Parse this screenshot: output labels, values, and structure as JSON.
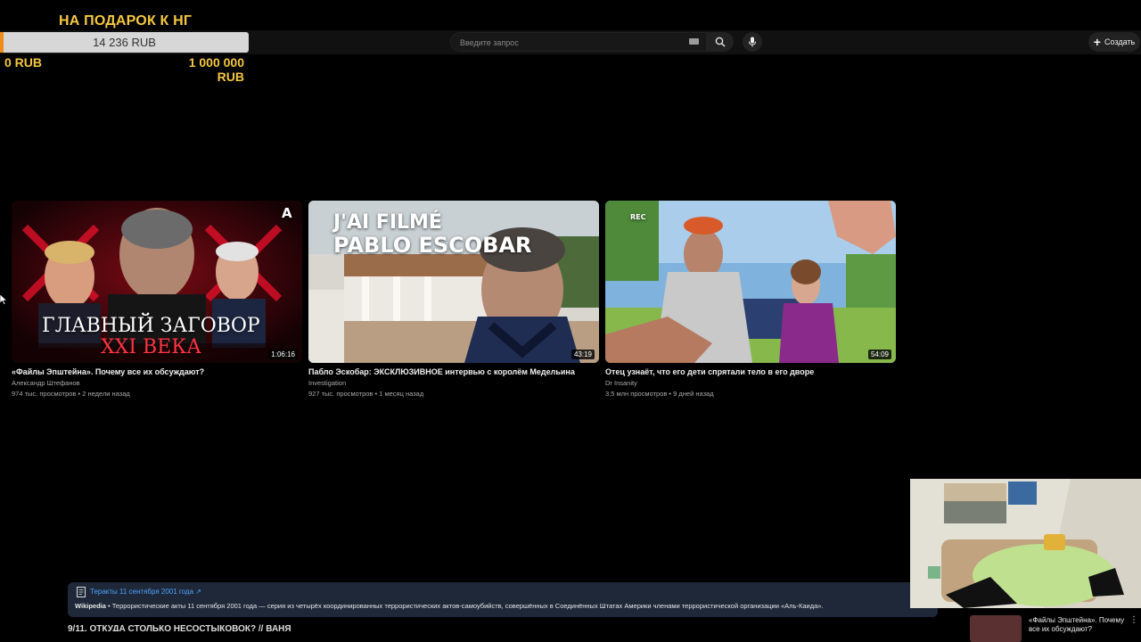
{
  "header": {
    "search_placeholder": "Введите запрос",
    "create_label": "Создать"
  },
  "donation": {
    "title": "НА ПОДАРОК К НГ",
    "current": "14 236 RUB",
    "min_label": "0 RUB",
    "max_label": "1 000 000 RUB",
    "progress_fraction": 0.014,
    "colors": {
      "accent": "#f5c842",
      "fill": "#f08c1a"
    }
  },
  "videos": [
    {
      "thumb_text_line1": "ГЛАВНЫЙ ЗАГОВОР",
      "thumb_text_line2": "XXI ВЕКА",
      "thumb_badge": "A",
      "duration": "1:06:16",
      "title": "«Файлы Эпштейна». Почему все их обсуждают?",
      "channel": "Александр Штефанов",
      "meta": "974 тыс. просмотров • 2 недели назад"
    },
    {
      "thumb_text_line1": "J'AI FILMÉ",
      "thumb_text_line2": "PABLO ESCOBAR",
      "duration": "43:19",
      "title": "Пабло Эскобар: ЭКСКЛЮЗИВНОЕ интервью с королём Медельина",
      "channel": "Investigation",
      "meta": "927 тыс. просмотров • 1 месяц назад"
    },
    {
      "thumb_rec": "REC",
      "duration": "54:09",
      "title": "Отец узнаёт, что его дети спрятали тело в его дворе",
      "channel": "Dr Insanity",
      "meta": "3,5 млн просмотров • 9 дней назад"
    }
  ],
  "info_panel": {
    "link": "Теракты 11 сентября 2001 года ↗",
    "source": "Wikipedia",
    "description": " • Террористические акты 11 сентября 2001 года — серия из четырёх координированных террористических актов-самоубийств, совершённых в Соединённых Штатах Америки членами террористической организации «Аль-Каида»."
  },
  "next_video_title": "9/11. ОТКУДА СТОЛЬКО НЕСОСТЫКОВОК? // ВАНЯ",
  "mini_player": {
    "title": "«Файлы Эпштейна». Почему все их обсуждают?"
  }
}
